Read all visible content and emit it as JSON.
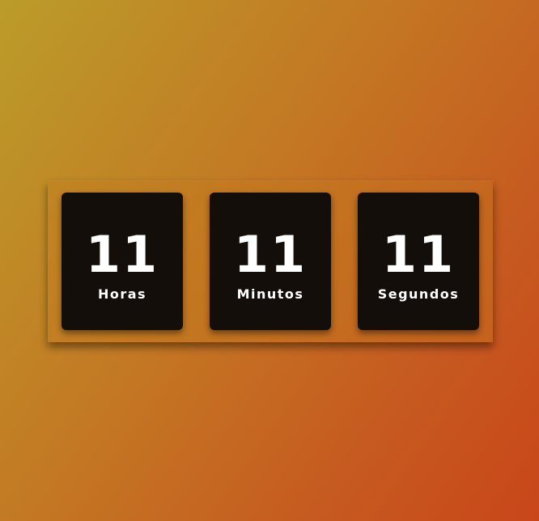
{
  "clock": {
    "hours": {
      "value": "11",
      "label": "Horas"
    },
    "minutes": {
      "value": "11",
      "label": "Minutos"
    },
    "seconds": {
      "value": "11",
      "label": "Segundos"
    }
  },
  "colors": {
    "background_start": "#bb9c2a",
    "background_end": "#c9461a",
    "box": "#140e0a",
    "text": "#ffffff"
  }
}
